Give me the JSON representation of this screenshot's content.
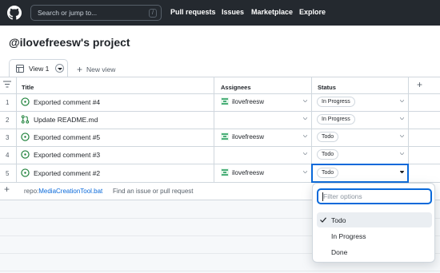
{
  "header": {
    "search_placeholder": "Search or jump to...",
    "search_shortcut": "/",
    "nav": [
      "Pull requests",
      "Issues",
      "Marketplace",
      "Explore"
    ]
  },
  "project": {
    "title": "@ilovefreesw's project"
  },
  "views": {
    "active_label": "View 1",
    "new_view_label": "New view"
  },
  "table": {
    "columns": [
      "Title",
      "Assignees",
      "Status"
    ],
    "rows": [
      {
        "num": "1",
        "icon": "issue-open-icon",
        "title": "Exported comment #4",
        "assignee": "ilovefreesw",
        "status": "In Progress"
      },
      {
        "num": "2",
        "icon": "pull-request-icon",
        "title": "Update README.md",
        "assignee": "",
        "status": "In Progress"
      },
      {
        "num": "3",
        "icon": "issue-open-icon",
        "title": "Exported comment #5",
        "assignee": "ilovefreesw",
        "status": "Todo"
      },
      {
        "num": "4",
        "icon": "issue-open-icon",
        "title": "Exported comment #3",
        "assignee": "",
        "status": "Todo"
      },
      {
        "num": "5",
        "icon": "issue-open-icon",
        "title": "Exported comment #2",
        "assignee": "ilovefreesw",
        "status": "Todo"
      }
    ],
    "add_row": {
      "repo_prefix": "repo:",
      "repo_name": "MediaCreationTool.bat",
      "hint": "Find an issue or pull request"
    }
  },
  "status_menu": {
    "filter_placeholder": "Filter options",
    "options": [
      "Todo",
      "In Progress",
      "Done"
    ],
    "selected": "Todo"
  },
  "colors": {
    "header_bg": "#24292f",
    "accent": "#0969da",
    "open_green": "#1a7f37",
    "border": "#d0d7de"
  }
}
